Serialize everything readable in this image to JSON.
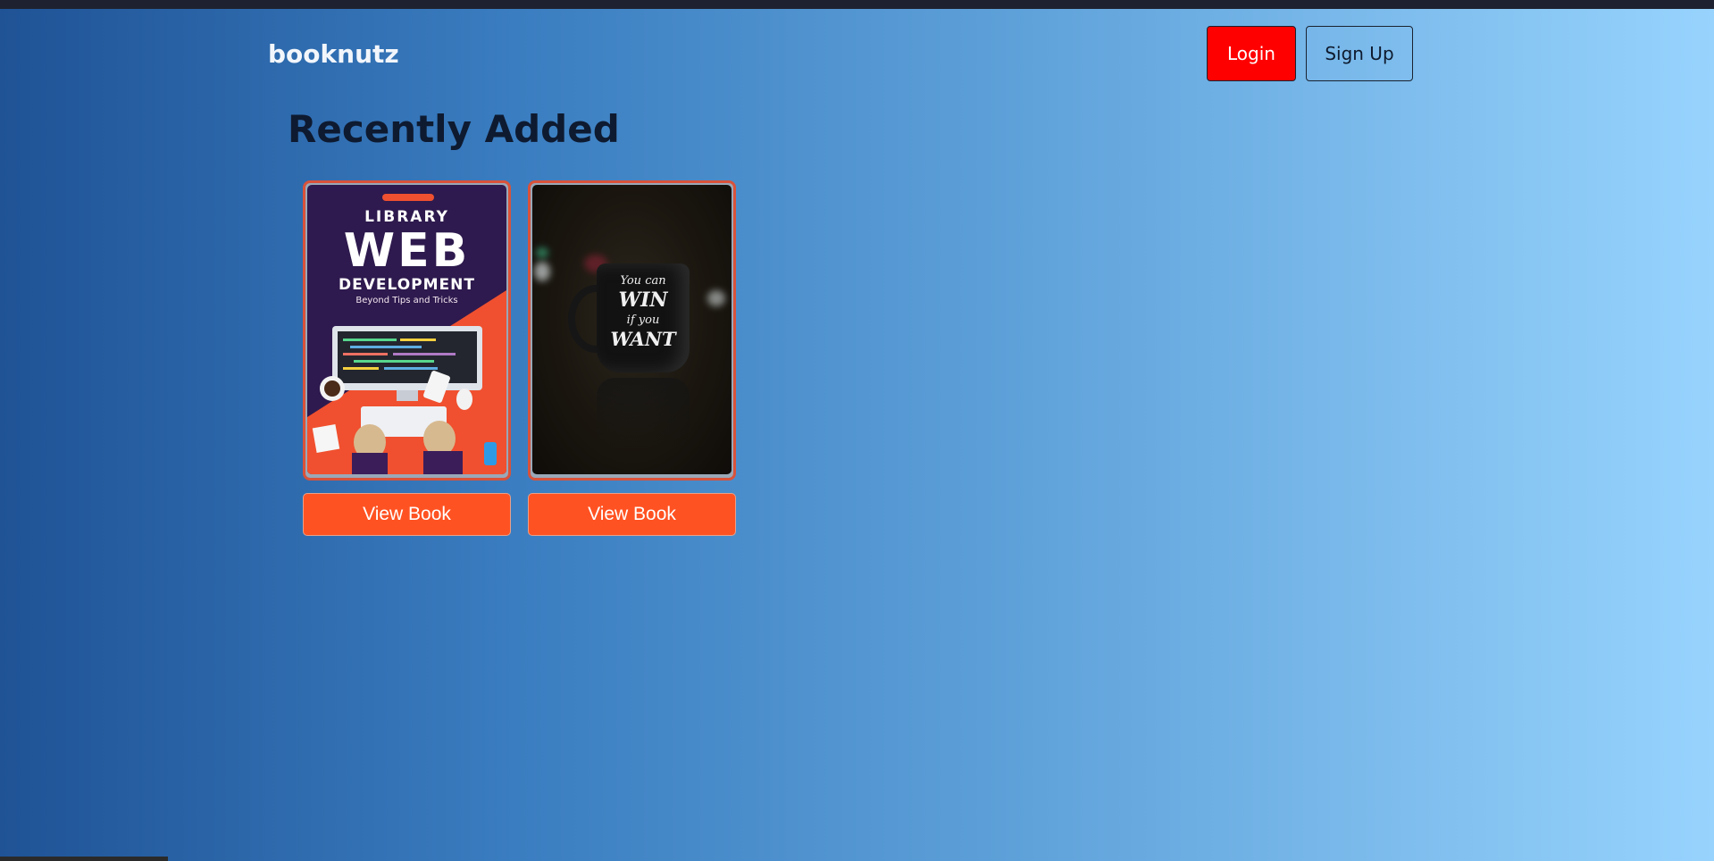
{
  "header": {
    "brand": "booknutz",
    "login_label": "Login",
    "signup_label": "Sign Up"
  },
  "main": {
    "heading": "Recently Added",
    "books": [
      {
        "cover": {
          "line1": "LIBRARY",
          "line2": "WEB",
          "line3": "DEVELOPMENT",
          "line4": "Beyond Tips and Tricks"
        },
        "button_label": "View Book"
      },
      {
        "cover": {
          "line1": "You can",
          "line2": "WIN",
          "line3": "if you",
          "line4": "WANT"
        },
        "button_label": "View Book"
      }
    ]
  },
  "colors": {
    "login_bg": "#ff0000",
    "view_button_bg": "#ff5222",
    "card_border": "#d9523a"
  }
}
